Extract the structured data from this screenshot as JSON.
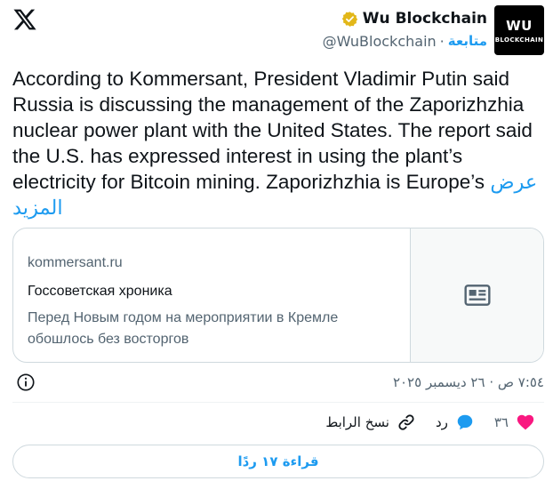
{
  "brand": {
    "logo_icon": "x-logo-icon"
  },
  "author": {
    "display_name": "Wu Blockchain",
    "handle": "@WuBlockchain",
    "follow_label": "متابعة",
    "separator": "·",
    "verified_icon": "verified-badge-icon",
    "avatar_top": "WU",
    "avatar_bottom": "BLOCKCHAIN"
  },
  "tweet": {
    "text": "According to Kommersant, President Vladimir Putin said Russia is discussing the management of the Zaporizhzhia nuclear power plant with the United States. The report said the U.S. has expressed interest in using the plant’s electricity for Bitcoin mining. Zaporizhzhia is Europe’s ",
    "show_more": "عرض المزيد"
  },
  "card": {
    "domain": "kommersant.ru",
    "title": "Госсоветская хроника",
    "description": "Перед Новым годом на мероприятии в Кремле обошлось без восторгов",
    "thumb_icon": "news-article-icon"
  },
  "meta": {
    "timestamp": "٧:٥٤ ص · ٢٦ ديسمبر ٢٠٢٥",
    "info_icon": "info-icon"
  },
  "actions": {
    "like_count": "٣٦",
    "like_icon": "heart-icon",
    "reply_label": "رد",
    "reply_icon": "reply-bubble-icon",
    "copy_link_label": "نسخ الرابط",
    "copy_link_icon": "link-icon"
  },
  "replies": {
    "label": "قراءة ١٧ ردًا"
  },
  "colors": {
    "accent": "#1d9bf0",
    "like": "#f91880",
    "text": "#0f1419",
    "muted": "#536471",
    "border": "#cfd9de",
    "verified_gold": "#e2b719"
  }
}
